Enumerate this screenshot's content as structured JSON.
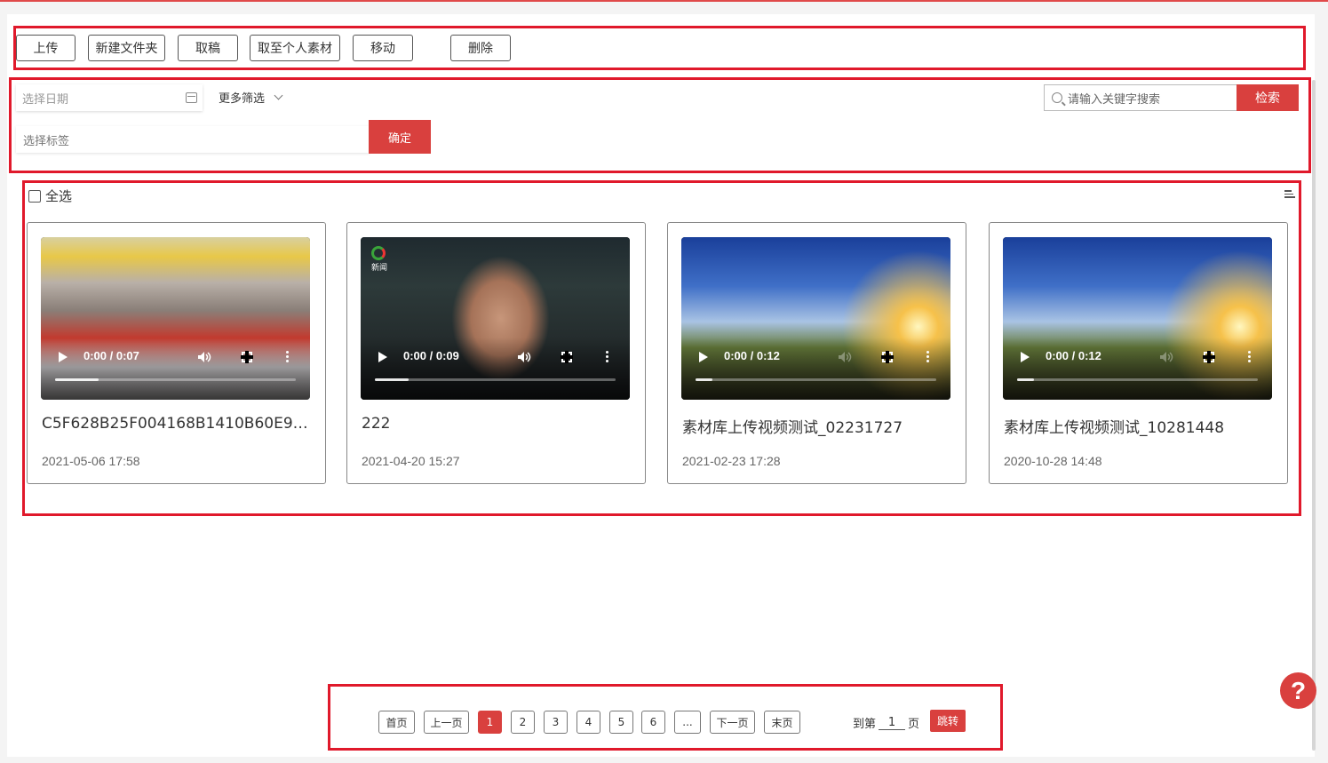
{
  "toolbar": {
    "upload": "上传",
    "new_folder": "新建文件夹",
    "withdraw": "取稿",
    "to_personal": "取至个人素材",
    "move": "移动",
    "delete": "删除"
  },
  "filter": {
    "date_placeholder": "选择日期",
    "more_filter": "更多筛选",
    "tag_placeholder": "选择标签",
    "confirm": "确定",
    "search_placeholder": "请输入关键字搜索",
    "search_button": "检索"
  },
  "list": {
    "select_all": "全选",
    "items": [
      {
        "title": "C5F628B25F004168B1410B60E9F...",
        "date": "2021-05-06 17:58",
        "time": "0:00 / 0:07",
        "progress": 0.18,
        "scene": "mall"
      },
      {
        "title": "222",
        "date": "2021-04-20 15:27",
        "time": "0:00 / 0:09",
        "progress": 0.14,
        "scene": "news",
        "logo_text": "新闻"
      },
      {
        "title": "素材库上传视频测试_02231727",
        "date": "2021-02-23 17:28",
        "time": "0:00 / 0:12",
        "progress": 0.07,
        "scene": "landscape"
      },
      {
        "title": "素材库上传视频测试_10281448",
        "date": "2020-10-28 14:48",
        "time": "0:00 / 0:12",
        "progress": 0.07,
        "scene": "landscape"
      }
    ]
  },
  "pagination": {
    "first": "首页",
    "prev": "上一页",
    "pages": [
      "1",
      "2",
      "3",
      "4",
      "5",
      "6"
    ],
    "ellipsis": "...",
    "next": "下一页",
    "last": "末页",
    "goto_prefix": "到第",
    "goto_value": "1",
    "goto_suffix": "页",
    "jump": "跳转",
    "current": "1"
  },
  "help": "?",
  "colors": {
    "accent": "#d9403e",
    "highlight_box": "#e0192b"
  }
}
